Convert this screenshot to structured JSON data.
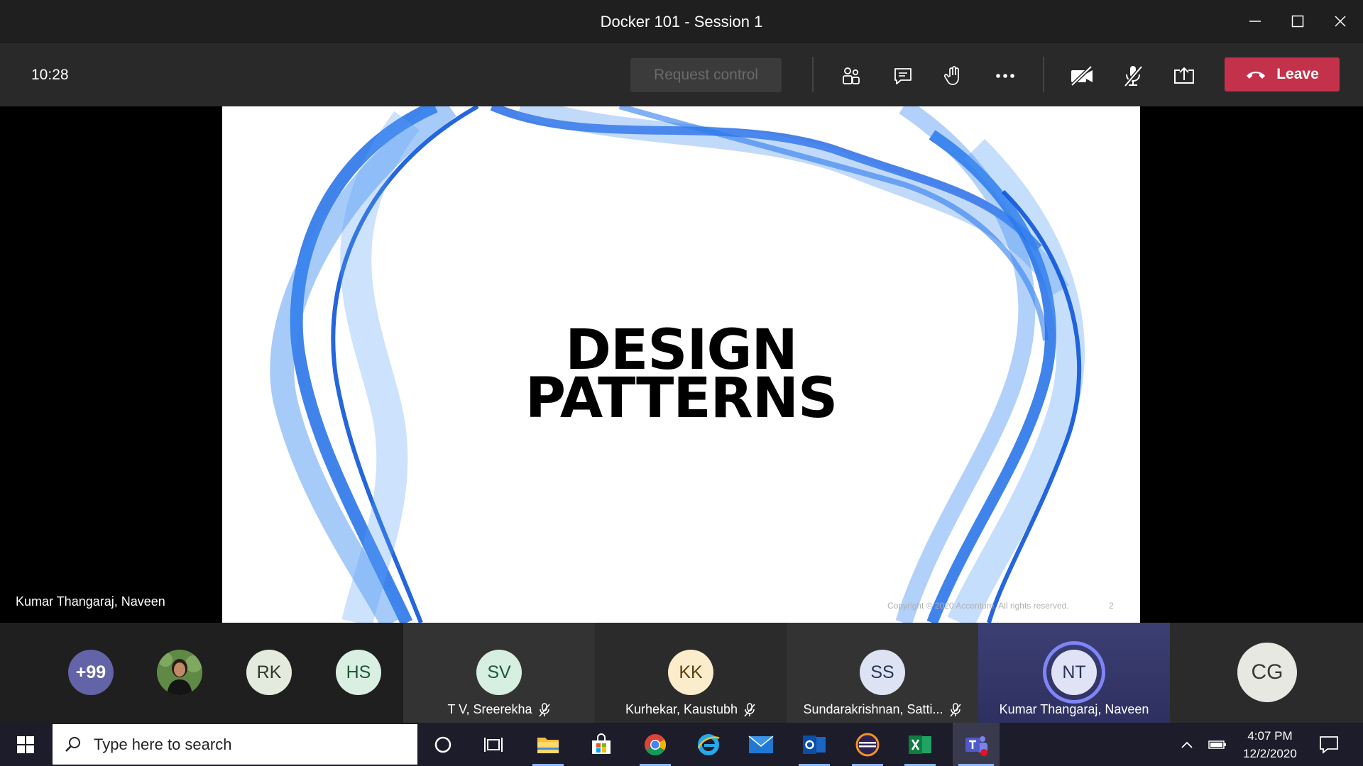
{
  "window": {
    "title": "Docker 101 - Session 1"
  },
  "toolbar": {
    "timer": "10:28",
    "request_control": "Request control",
    "leave": "Leave"
  },
  "slide": {
    "title_line1": "DESIGN",
    "title_line2": "PATTERNS",
    "footer": "Copyright © 2020 Accenture. All rights reserved.",
    "page": "2"
  },
  "presenter_name": "Kumar Thangaraj, Naveen",
  "participants": {
    "overflow": "+99",
    "avatars": [
      {
        "initials": "RK"
      },
      {
        "initials": "HS"
      }
    ],
    "tiles": [
      {
        "initials": "SV",
        "name": "T V, Sreerekha"
      },
      {
        "initials": "KK",
        "name": "Kurhekar, Kaustubh"
      },
      {
        "initials": "SS",
        "name": "Sundarakrishnan, Satti..."
      },
      {
        "initials": "NT",
        "name": "Kumar Thangaraj, Naveen"
      },
      {
        "initials": "CG",
        "name": ""
      }
    ]
  },
  "taskbar": {
    "search_placeholder": "Type here to search",
    "time": "4:07 PM",
    "date": "12/2/2020"
  },
  "colors": {
    "leave": "#c4314b",
    "overflow_avatar": "#6264a7",
    "active_ring": "#7f85f5"
  }
}
